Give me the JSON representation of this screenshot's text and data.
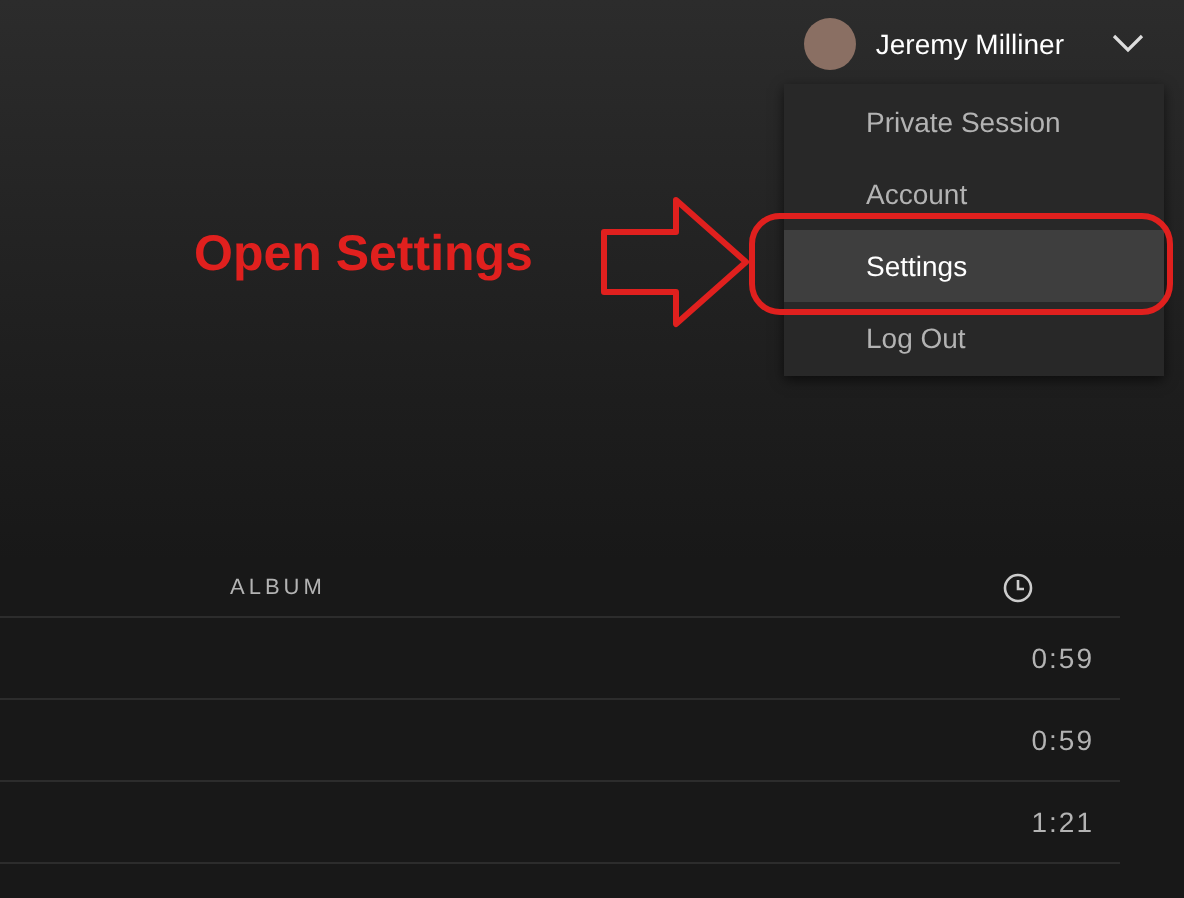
{
  "user": {
    "name": "Jeremy Milliner"
  },
  "menu": {
    "items": [
      {
        "label": "Private Session",
        "selected": false
      },
      {
        "label": "Account",
        "selected": false
      },
      {
        "label": "Settings",
        "selected": true
      },
      {
        "label": "Log Out",
        "selected": false
      }
    ]
  },
  "annotation": {
    "text": "Open Settings"
  },
  "table": {
    "columns": [
      "ALBUM"
    ],
    "rows": [
      {
        "duration": "0:59"
      },
      {
        "duration": "0:59"
      },
      {
        "duration": "1:21"
      }
    ]
  }
}
